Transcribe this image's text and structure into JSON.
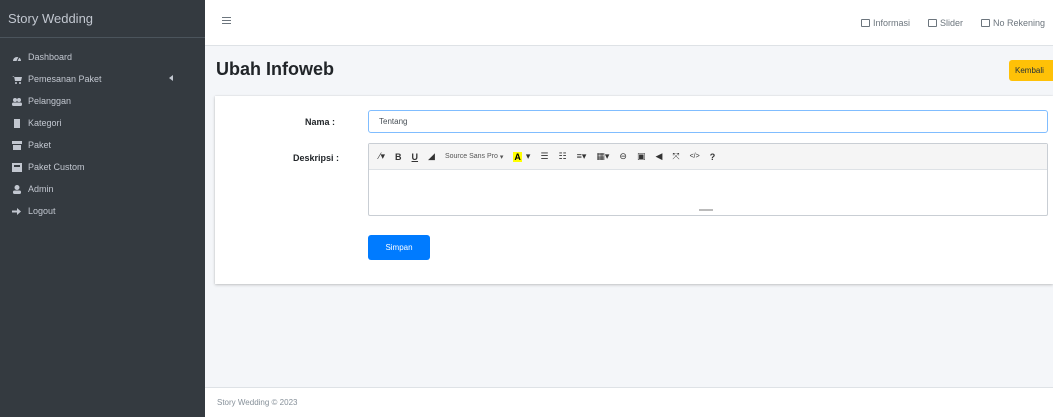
{
  "sidebar": {
    "brand": "Story Wedding",
    "items": [
      {
        "label": "Dashboard",
        "icon": "dashboard-icon"
      },
      {
        "label": "Pemesanan Paket",
        "icon": "cart-icon"
      },
      {
        "label": "Pelanggan",
        "icon": "users-icon"
      },
      {
        "label": "Kategori",
        "icon": "book-icon"
      },
      {
        "label": "Paket",
        "icon": "box-icon"
      },
      {
        "label": "Paket Custom",
        "icon": "custom-box-icon"
      },
      {
        "label": "Admin",
        "icon": "user-icon"
      },
      {
        "label": "Logout",
        "icon": "logout-icon"
      }
    ]
  },
  "topbar": {
    "links": [
      {
        "label": "Informasi",
        "icon": "info-icon"
      },
      {
        "label": "Slider",
        "icon": "image-icon"
      },
      {
        "label": "No Rekening",
        "icon": "bank-icon"
      }
    ]
  },
  "header": {
    "title": "Ubah Infoweb",
    "back_label": "Kembali"
  },
  "form": {
    "name_label": "Nama :",
    "name_value": "Tentang",
    "desc_label": "Deskripsi :",
    "font_select": "Source Sans Pro",
    "save_label": "Simpan"
  },
  "footer": {
    "text": "Story Wedding © 2023"
  },
  "colors": {
    "sidebar": "#343a40",
    "primary": "#007bff",
    "warning": "#ffc107"
  }
}
